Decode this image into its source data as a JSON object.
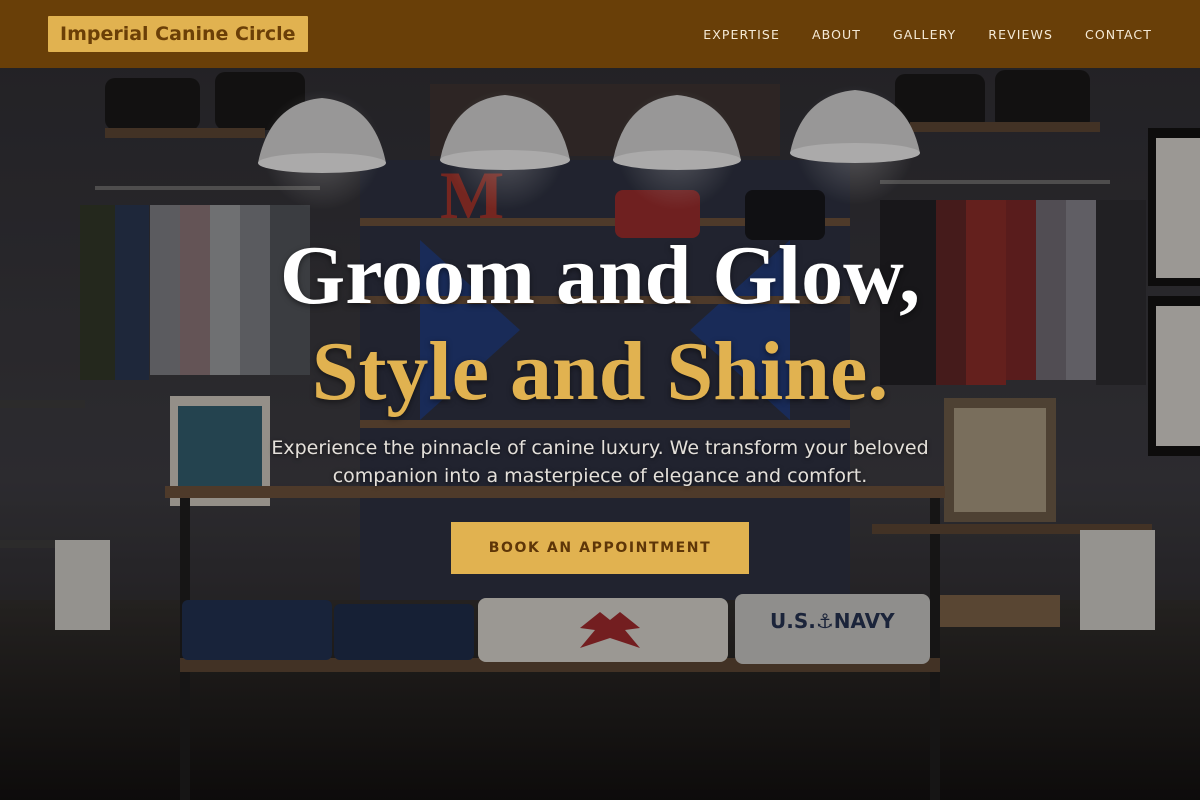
{
  "brand": {
    "name": "Imperial Canine Circle"
  },
  "nav": {
    "items": [
      {
        "label": "EXPERTISE"
      },
      {
        "label": "ABOUT"
      },
      {
        "label": "GALLERY"
      },
      {
        "label": "REVIEWS"
      },
      {
        "label": "CONTACT"
      }
    ]
  },
  "hero": {
    "headline_line1": "Groom and Glow,",
    "headline_line2": "Style and Shine.",
    "subtitle": "Experience the pinnacle of canine luxury. We transform your beloved companion into a masterpiece of elegance and comfort.",
    "cta_label": "BOOK AN APPOINTMENT",
    "background_image": "boutique-store-interior-photo"
  },
  "colors": {
    "header_bg": "#693f08",
    "accent_gold": "#e1b250",
    "text_light": "#ffffff"
  }
}
